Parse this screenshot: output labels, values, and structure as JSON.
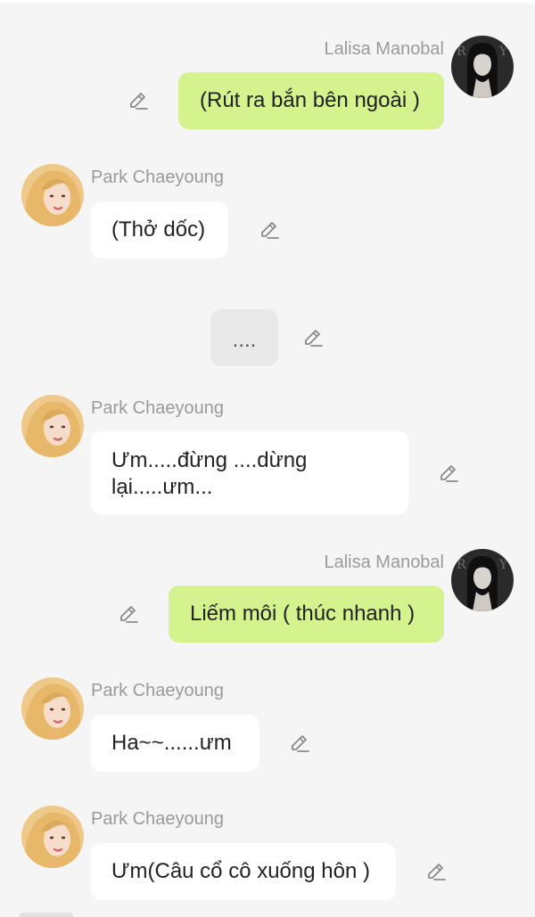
{
  "messages": [
    {
      "sender": "Lalisa Manobal",
      "text": "(Rút ra bắn bên ngoài )",
      "side": "right"
    },
    {
      "sender": "Park Chaeyoung",
      "text": "(Thở dốc)",
      "side": "left"
    },
    {
      "sender": "",
      "text": "....",
      "side": "center"
    },
    {
      "sender": "Park Chaeyoung",
      "text_lines": [
        "Ưm.....đừng ....dừng",
        "lại.....ưm..."
      ],
      "side": "left"
    },
    {
      "sender": "Lalisa Manobal",
      "text": "Liếm môi ( thúc nhanh )",
      "side": "right"
    },
    {
      "sender": "Park Chaeyoung",
      "text": "Ha~~......ưm",
      "side": "left"
    },
    {
      "sender": "Park Chaeyoung",
      "text": "Ưm(Câu cổ cô xuống hôn )",
      "side": "left"
    }
  ],
  "icons": {
    "edit": "pencil-icon",
    "avatar_lisa": "avatar-lalisa-manobal",
    "avatar_rose": "avatar-park-chaeyoung"
  },
  "colors": {
    "background": "#f5f5f5",
    "right_bubble": "#d4f28e",
    "left_bubble": "#ffffff",
    "narration_bubble": "#e9e9e9",
    "sender_name": "#9a9a9a"
  }
}
